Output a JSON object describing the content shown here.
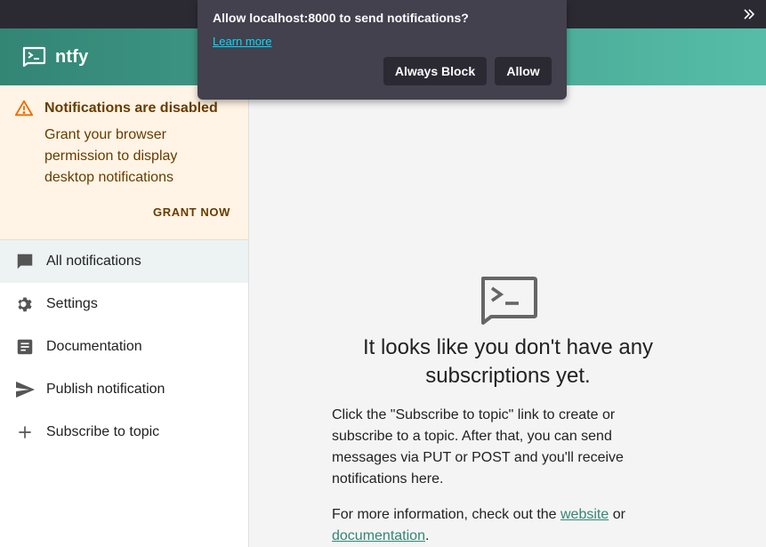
{
  "browser": {
    "overflow_icon": "double-chevron-right-icon"
  },
  "popup": {
    "message": "Allow localhost:8000 to send notifications?",
    "learn_more": "Learn more",
    "block_label": "Always Block",
    "allow_label": "Allow"
  },
  "app": {
    "name": "ntfy",
    "logo_icon": "terminal-chat-icon",
    "brand_color": "#338574"
  },
  "sidebar": {
    "alert": {
      "icon": "warning-icon",
      "title": "Notifications are disabled",
      "text": "Grant your browser permission to display desktop notifications",
      "action": "GRANT NOW"
    },
    "items": [
      {
        "label": "All notifications",
        "icon": "chat-bubble-icon",
        "active": true
      },
      {
        "label": "Settings",
        "icon": "gear-icon"
      },
      {
        "label": "Documentation",
        "icon": "article-icon"
      },
      {
        "label": "Publish notification",
        "icon": "send-icon"
      },
      {
        "label": "Subscribe to topic",
        "icon": "plus-icon"
      }
    ]
  },
  "main": {
    "empty_icon": "terminal-chat-icon",
    "title": "It looks like you don't have any subscriptions yet.",
    "description": "Click the \"Subscribe to topic\" link to create or subscribe to a topic. After that, you can send messages via PUT or POST and you'll receive notifications here.",
    "more_info_prefix": "For more information, check out the ",
    "website_link": "website",
    "more_info_middle": " or ",
    "docs_link": "documentation",
    "more_info_suffix": "."
  }
}
